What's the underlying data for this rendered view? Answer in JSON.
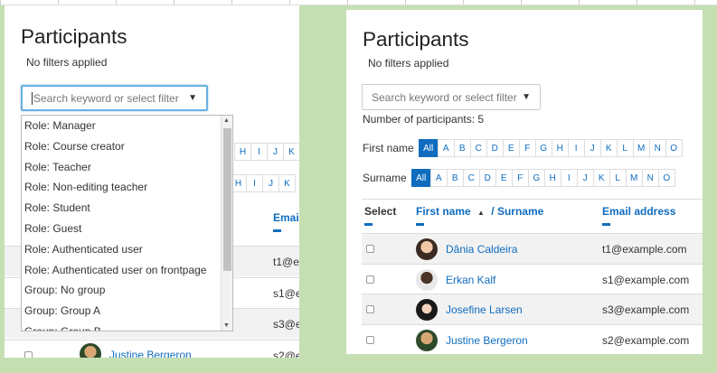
{
  "left": {
    "title": "Participants",
    "filters_status": "No filters applied",
    "search_placeholder": "Search keyword or select filter",
    "dropdown_items": [
      "Role: Manager",
      "Role: Course creator",
      "Role: Teacher",
      "Role: Non-editing teacher",
      "Role: Student",
      "Role: Guest",
      "Role: Authenticated user",
      "Role: Authenticated user on frontpage",
      "Group: No group",
      "Group: Group A",
      "Group: Group B"
    ],
    "first_name_letters": [
      "H",
      "I",
      "J",
      "K"
    ],
    "surname_letters": [
      "H",
      "I",
      "J",
      "K"
    ],
    "email_header": "Email",
    "emails_partial": [
      "t1@e",
      "s1@e",
      "s3@e",
      "s2@e"
    ],
    "last_row_name": "Justine Bergeron"
  },
  "right": {
    "title": "Participants",
    "filters_status": "No filters applied",
    "search_placeholder": "Search keyword or select filter",
    "participants_count": "Number of participants: 5",
    "first_name_label": "First name",
    "surname_label": "Surname",
    "letters": [
      "All",
      "A",
      "B",
      "C",
      "D",
      "E",
      "F",
      "G",
      "H",
      "I",
      "J",
      "K",
      "L",
      "M",
      "N",
      "O"
    ],
    "surname_letters": [
      "All",
      "A",
      "B",
      "C",
      "D",
      "E",
      "F",
      "G",
      "H",
      "I",
      "J",
      "K",
      "L",
      "M",
      "N",
      "O"
    ],
    "table": {
      "col_select": "Select",
      "col_first_name": "First name",
      "col_surname": "/ Surname",
      "col_email": "Email address",
      "rows": [
        {
          "name": "Dânia Caldeira",
          "email": "t1@example.com"
        },
        {
          "name": "Erkan Kalf",
          "email": "s1@example.com"
        },
        {
          "name": "Josefine Larsen",
          "email": "s3@example.com"
        },
        {
          "name": "Justine Bergeron",
          "email": "s2@example.com"
        }
      ]
    }
  },
  "icons": {
    "caret": "▼",
    "sort_asc": "▲"
  },
  "colors": {
    "link": "#0f6cbf",
    "background_green": "#c5dfb3",
    "focus_border": "#6ab0e0"
  }
}
